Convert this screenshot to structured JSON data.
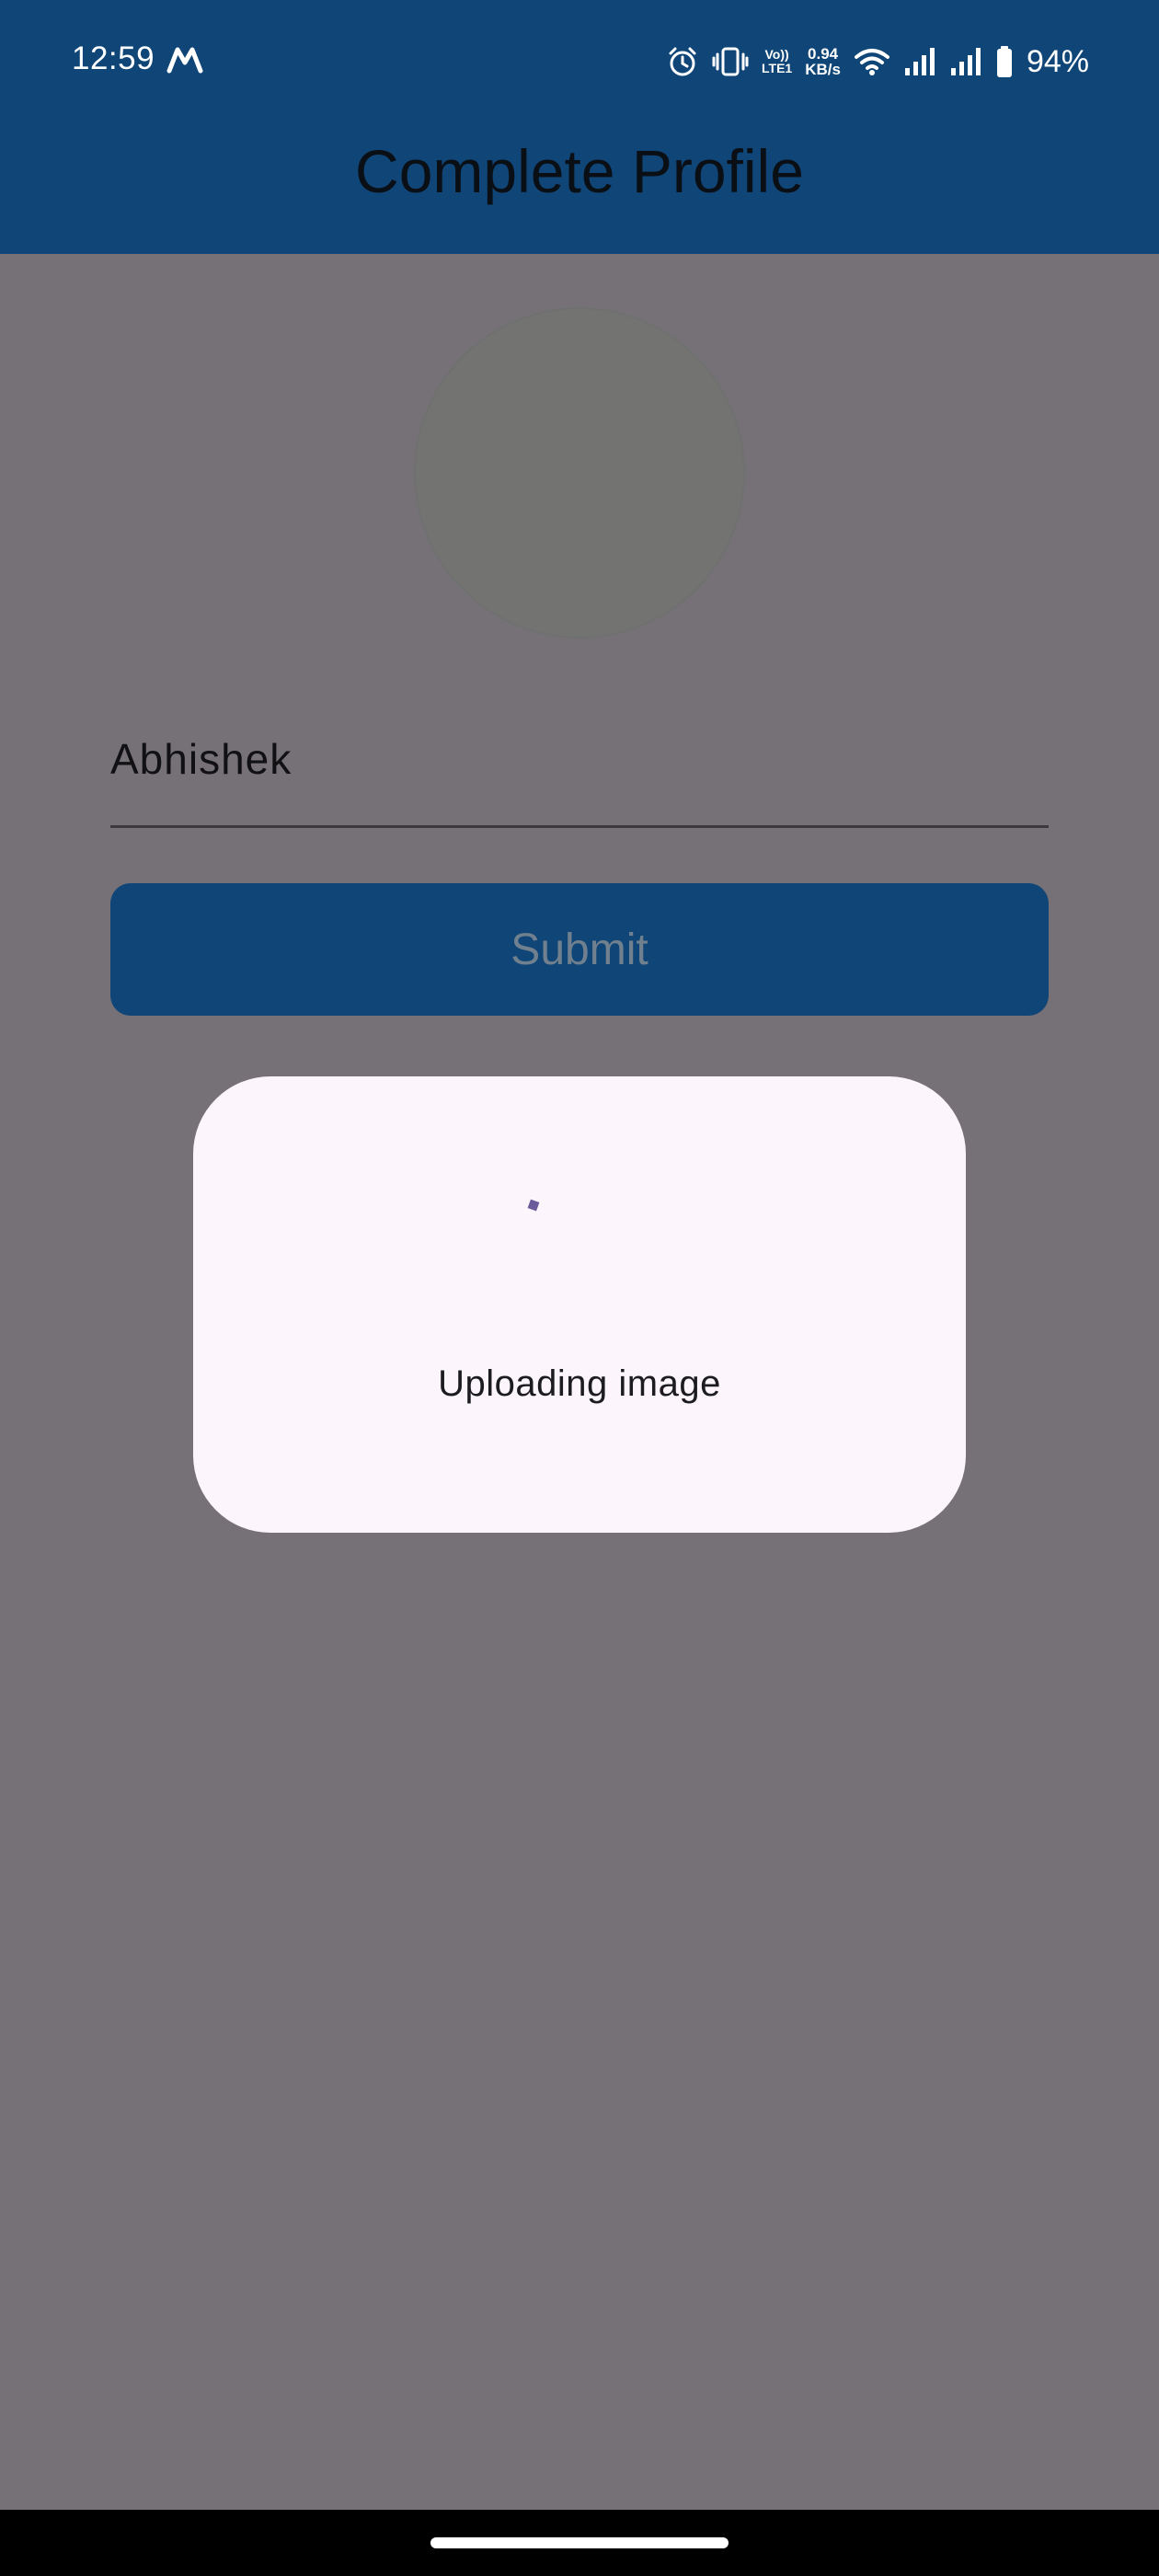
{
  "status_bar": {
    "time": "12:59",
    "app_notification_icon": "m-logo-icon",
    "icons": [
      "alarm-icon",
      "vibrate-icon",
      "volte-icon",
      "wifi-icon",
      "signal-icon",
      "signal-icon",
      "battery-icon"
    ],
    "volte_top": "Vo))",
    "volte_bottom": "LTE1",
    "net_speed_value": "0.94",
    "net_speed_unit": "KB/s",
    "battery_percent": "94%"
  },
  "app_bar": {
    "title": "Complete Profile",
    "background_color": "#104677"
  },
  "profile": {
    "avatar_icon": "avatar-placeholder",
    "name_value": "Abhishek",
    "submit_label": "Submit"
  },
  "dialog": {
    "message": "Uploading image",
    "spinner_color": "#6a5b9a"
  },
  "colors": {
    "scrim": "#767176",
    "dialog_background": "#fcf5fc",
    "accent": "#104677"
  }
}
